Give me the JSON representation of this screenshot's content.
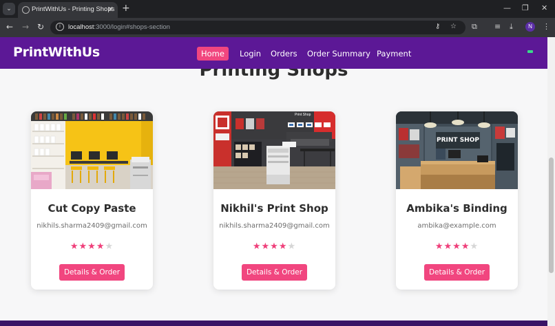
{
  "browser": {
    "tab_title": "PrintWithUs - Printing Shops",
    "url_host": "localhost",
    "url_path": ":3000/login#shops-section",
    "profile_initial": "N"
  },
  "site": {
    "brand": "PrintWithUs",
    "nav": [
      {
        "label": "Home",
        "active": true
      },
      {
        "label": "Login",
        "active": false
      },
      {
        "label": "Orders",
        "active": false
      },
      {
        "label": "Order Summary",
        "active": false
      },
      {
        "label": "Payment",
        "active": false
      }
    ],
    "section_title": "Printing Shops",
    "shops": [
      {
        "name": "Cut Copy Paste",
        "email": "nikhils.sharma2409@gmail.com",
        "rating": 4,
        "rating_max": 5,
        "button": "Details & Order",
        "image": "yellow-print-room-photo"
      },
      {
        "name": "Nikhil's Print Shop",
        "email": "nikhils.sharma2409@gmail.com",
        "rating": 4,
        "rating_max": 5,
        "button": "Details & Order",
        "image": "print-shop-interior-photo",
        "image_sign": "Print Shop"
      },
      {
        "name": "Ambika's Binding",
        "email": "ambika@example.com",
        "rating": 4,
        "rating_max": 5,
        "button": "Details & Order",
        "image": "print-shop-counter-photo",
        "image_sign": "PRINT SHOP"
      }
    ]
  },
  "colors": {
    "navbar": "#5c1896",
    "accent": "#f1467f",
    "star": "#ef3f7a",
    "star_empty": "#d6d6d6"
  }
}
